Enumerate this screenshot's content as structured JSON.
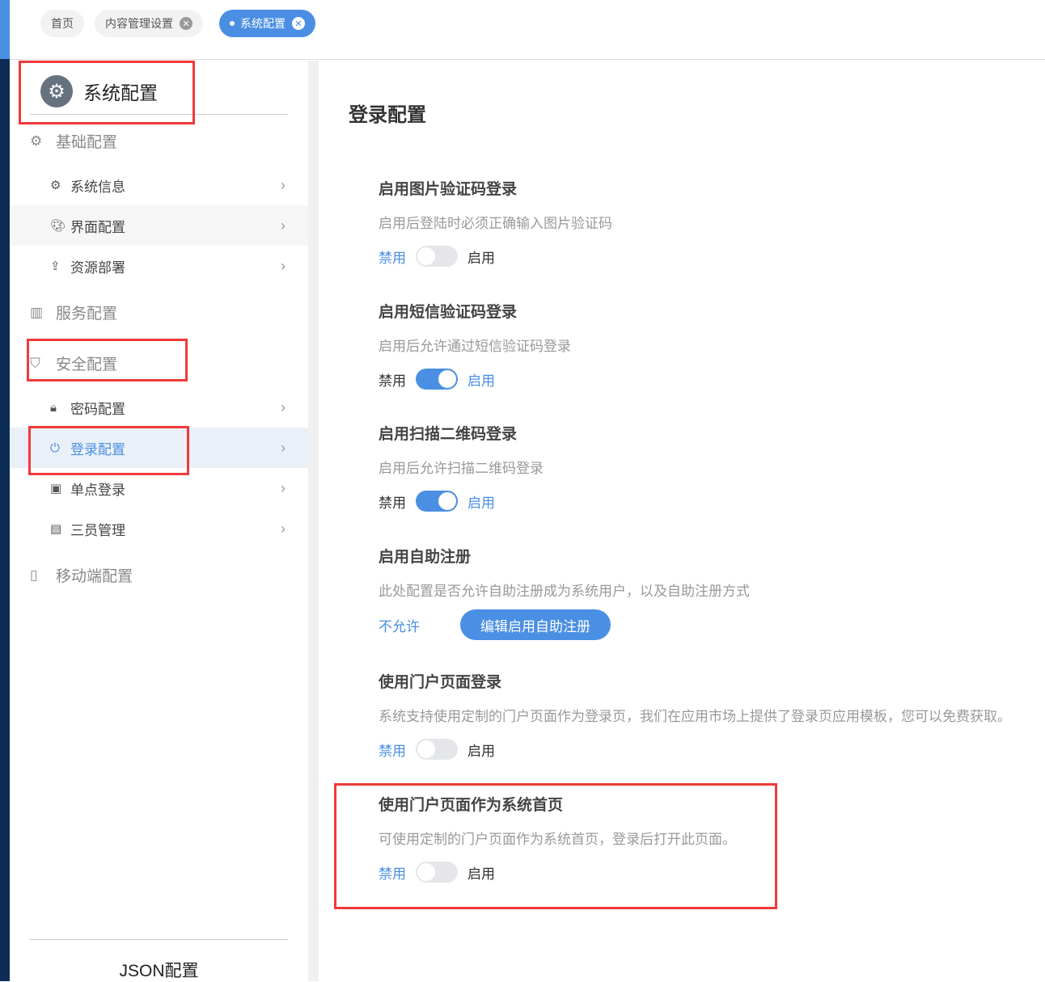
{
  "tabs": [
    {
      "label": "首页"
    },
    {
      "label": "内容管理设置"
    },
    {
      "label": "系统配置"
    }
  ],
  "sidebar": {
    "title": "系统配置",
    "groups": [
      {
        "label": "基础配置",
        "items": [
          {
            "label": "系统信息"
          },
          {
            "label": "界面配置"
          },
          {
            "label": "资源部署"
          }
        ]
      },
      {
        "label": "服务配置"
      },
      {
        "label": "安全配置",
        "items": [
          {
            "label": "密码配置"
          },
          {
            "label": "登录配置"
          },
          {
            "label": "单点登录"
          },
          {
            "label": "三员管理"
          }
        ]
      },
      {
        "label": "移动端配置"
      }
    ],
    "footer": "JSON配置"
  },
  "main": {
    "title": "登录配置",
    "sections": [
      {
        "title": "启用图片验证码登录",
        "desc": "启用后登陆时必须正确输入图片验证码",
        "off": "禁用",
        "on": "启用",
        "enabled": false
      },
      {
        "title": "启用短信验证码登录",
        "desc": "启用后允许通过短信验证码登录",
        "off": "禁用",
        "on": "启用",
        "enabled": true
      },
      {
        "title": "启用扫描二维码登录",
        "desc": "启用后允许扫描二维码登录",
        "off": "禁用",
        "on": "启用",
        "enabled": true
      },
      {
        "title": "启用自助注册",
        "desc": "此处配置是否允许自助注册成为系统用户，以及自助注册方式",
        "status": "不允许",
        "button": "编辑启用自助注册"
      },
      {
        "title": "使用门户页面登录",
        "desc": "系统支持使用定制的门户页面作为登录页，我们在应用市场上提供了登录页应用模板，您可以免费获取。",
        "off": "禁用",
        "on": "启用",
        "enabled": false
      },
      {
        "title": "使用门户页面作为系统首页",
        "desc": "可使用定制的门户页面作为系统首页，登录后打开此页面。",
        "off": "禁用",
        "on": "启用",
        "enabled": false
      }
    ]
  },
  "colors": {
    "accent": "#4a8fe3",
    "navy": "#0d2c55",
    "annotation": "#f03a3a"
  }
}
